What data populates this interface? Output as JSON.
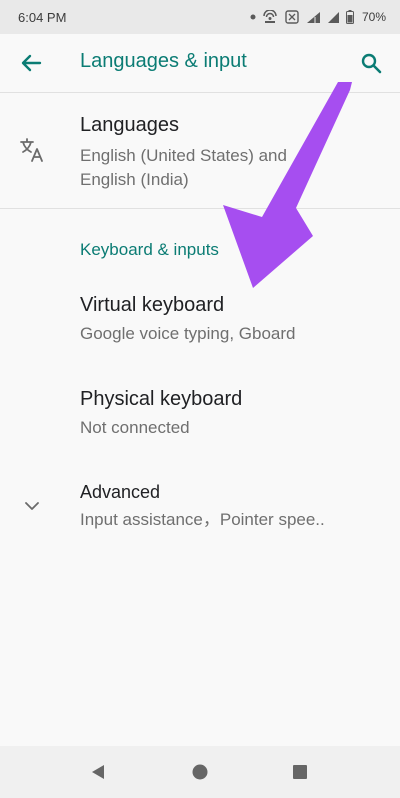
{
  "status_bar": {
    "time": "6:04 PM",
    "battery": "70%",
    "icons": [
      "dot-icon",
      "hotspot-icon",
      "data-saver-icon",
      "wifi-icon",
      "signal-icon",
      "battery-icon"
    ]
  },
  "app_bar": {
    "title": "Languages & input",
    "back_icon": "arrow-left-icon",
    "search_icon": "search-icon"
  },
  "languages": {
    "title": "Languages",
    "subtitle_line1": "English (United States) and",
    "subtitle_line2": "English (India)",
    "icon": "translate-icon"
  },
  "section": {
    "keyboard_inputs": "Keyboard & inputs"
  },
  "virtual_keyboard": {
    "title": "Virtual keyboard",
    "subtitle": "Google voice typing, Gboard"
  },
  "physical_keyboard": {
    "title": "Physical keyboard",
    "subtitle": "Not connected"
  },
  "advanced": {
    "title": "Advanced",
    "subtitle": "Input assistance，Pointer spee..",
    "icon": "chevron-down-icon"
  },
  "colors": {
    "accent": "#0b7c74",
    "annotation_arrow": "#a64ef0",
    "status_bar_bg": "#e9e9e9",
    "page_bg": "#f9f9f9"
  },
  "nav_bar": {
    "icons": [
      "back-triangle-icon",
      "home-circle-icon",
      "recents-square-icon"
    ]
  }
}
